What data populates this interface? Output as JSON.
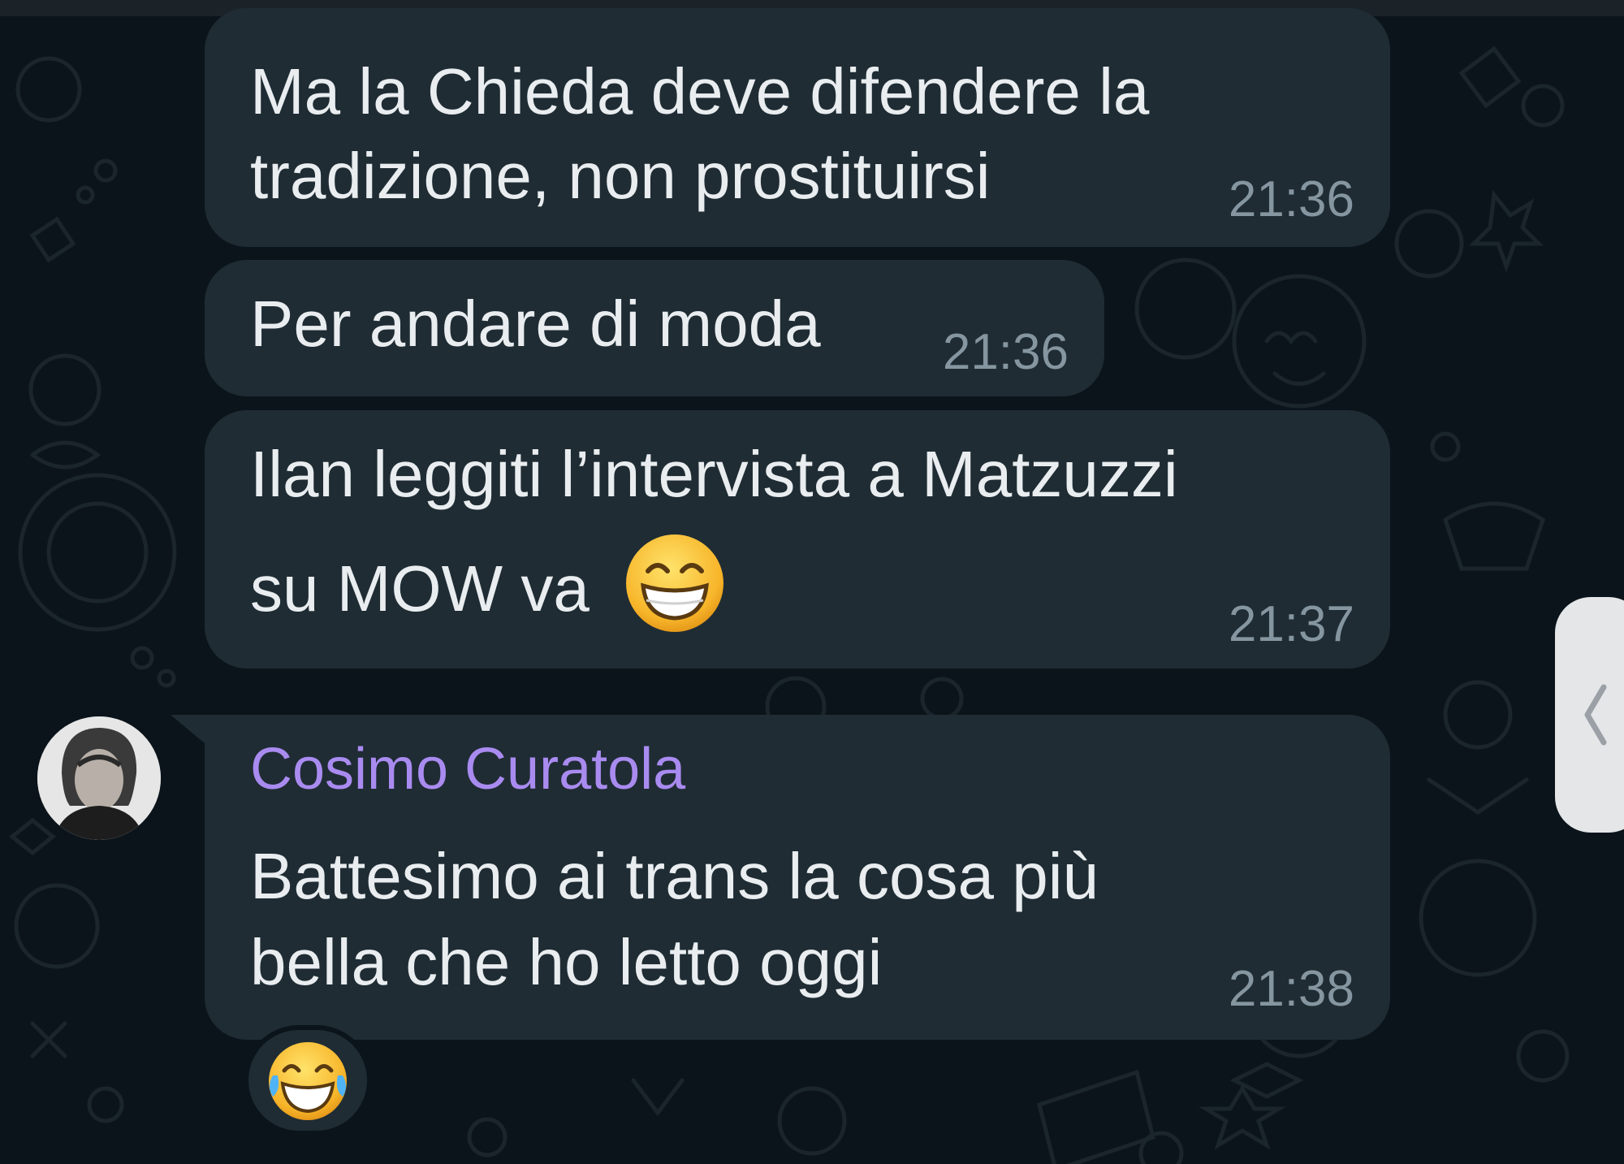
{
  "theme": {
    "background": "#0b141a",
    "bubble": "#1f2c34",
    "text": "#e9edef",
    "time": "#8696a0",
    "sender_name": "#a98bf0"
  },
  "messages": [
    {
      "lines": [
        "Ma la Chieda deve difendere la",
        "tradizione, non prostituirsi"
      ],
      "time": "21:36"
    },
    {
      "lines": [
        "Per andare di moda"
      ],
      "time": "21:36"
    },
    {
      "lines": [
        "Ilan leggiti l’intervista a Matzuzzi",
        "su MOW va"
      ],
      "emoji": "grinning-face-icon",
      "time": "21:37"
    },
    {
      "sender": "Cosimo Curatola",
      "lines": [
        "Battesimo ai trans la cosa più",
        "bella che ho letto oggi"
      ],
      "time": "21:38",
      "reaction": "face-with-tears-of-joy-icon"
    }
  ],
  "side_panel_handle": {
    "icon": "chevron-left-icon"
  }
}
